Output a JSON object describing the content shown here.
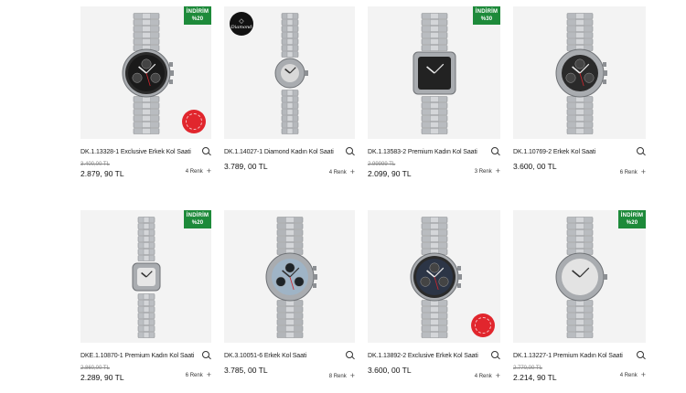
{
  "products": [
    {
      "title": "DK.1.13328-1 Exclusive Erkek Kol Saati",
      "old_price": "3.400,00 TL",
      "price": "2.879, 90 TL",
      "colors": "4 Renk",
      "badge": [
        "İNDİRİM",
        "%20"
      ],
      "dial": "#1a1a1a",
      "bracelet": "#b9bcc0",
      "style": "chrono-sport"
    },
    {
      "title": "DK.1.14027-1 Diamond Kadın Kol Saati",
      "old_price": "",
      "price": "3.789, 00 TL",
      "colors": "4 Renk",
      "badge": null,
      "dial": "#d9d9d9",
      "bracelet": "#b5b8bc",
      "style": "lady-round"
    },
    {
      "title": "DK.1.13583-2 Premium Kadın Kol Saati",
      "old_price": "2.99999 TL",
      "price": "2.099, 90 TL",
      "colors": "3 Renk",
      "badge": [
        "İNDİRİM",
        "%30"
      ],
      "dial": "#222222",
      "bracelet": "#b9bcc0",
      "style": "square"
    },
    {
      "title": "DK.1.10769-2 Erkek Kol Saati",
      "old_price": "",
      "price": "3.600, 00 TL",
      "colors": "6 Renk",
      "badge": null,
      "dial": "#2a2a2a",
      "bracelet": "#b7babe",
      "style": "chrono"
    },
    {
      "title": "DKE.1.10870-1 Premium Kadın Kol Saati",
      "old_price": "2.860,00 TL",
      "price": "2.289, 90 TL",
      "colors": "6 Renk",
      "badge": [
        "İNDİRİM",
        "%20"
      ],
      "dial": "#e6e6e6",
      "bracelet": "#bcbfc3",
      "style": "lady-square"
    },
    {
      "title": "DK.3.10051-6 Erkek Kol Saati",
      "old_price": "",
      "price": "3.785, 00 TL",
      "colors": "8 Renk",
      "badge": null,
      "dial": "#9fb4c6",
      "bracelet": "#b2b5b9",
      "style": "chrono"
    },
    {
      "title": "DK.1.13892-2 Exclusive Erkek Kol Saati",
      "old_price": "",
      "price": "3.600, 00 TL",
      "colors": "4 Renk",
      "badge": null,
      "dial": "#2c3546",
      "bracelet": "#b9bcc0",
      "style": "chrono-sport"
    },
    {
      "title": "DK.1.13227-1 Premium Kadın Kol Saati",
      "old_price": "2.770,00 TL",
      "price": "2.214, 90 TL",
      "colors": "4 Renk",
      "badge": [
        "İNDİRİM",
        "%20"
      ],
      "dial": "#e3e3e3",
      "bracelet": "#b9bcc0",
      "style": "roman"
    }
  ],
  "diamond_logo_text": "Diamond",
  "colors": {
    "badge_green": "#1d8a3a",
    "stamp_red": "#e1262d",
    "thumb_bg": "#f3f3f3"
  },
  "icons": {
    "search": "search-icon",
    "add": "plus-icon"
  }
}
